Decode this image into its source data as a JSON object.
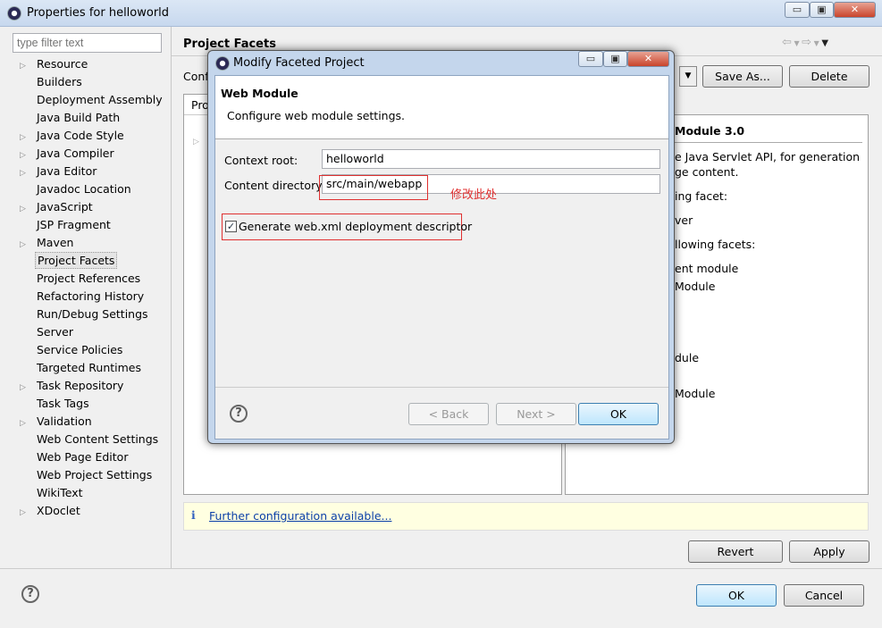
{
  "window": {
    "title": "Properties for helloworld",
    "controls": [
      "▭",
      "▣",
      "✕"
    ]
  },
  "filter": {
    "placeholder": "type filter text"
  },
  "tree": [
    {
      "label": "Resource",
      "exp": true
    },
    {
      "label": "Builders"
    },
    {
      "label": "Deployment Assembly"
    },
    {
      "label": "Java Build Path"
    },
    {
      "label": "Java Code Style",
      "exp": true
    },
    {
      "label": "Java Compiler",
      "exp": true
    },
    {
      "label": "Java Editor",
      "exp": true
    },
    {
      "label": "Javadoc Location"
    },
    {
      "label": "JavaScript",
      "exp": true
    },
    {
      "label": "JSP Fragment"
    },
    {
      "label": "Maven",
      "exp": true
    },
    {
      "label": "Project Facets",
      "sel": true
    },
    {
      "label": "Project References"
    },
    {
      "label": "Refactoring History"
    },
    {
      "label": "Run/Debug Settings"
    },
    {
      "label": "Server"
    },
    {
      "label": "Service Policies"
    },
    {
      "label": "Targeted Runtimes"
    },
    {
      "label": "Task Repository",
      "exp": true
    },
    {
      "label": "Task Tags"
    },
    {
      "label": "Validation",
      "exp": true
    },
    {
      "label": "Web Content Settings"
    },
    {
      "label": "Web Page Editor"
    },
    {
      "label": "Web Project Settings"
    },
    {
      "label": "WikiText"
    },
    {
      "label": "XDoclet",
      "exp": true
    }
  ],
  "main": {
    "title": "Project Facets",
    "config_label": "Conf",
    "save_as": "Save As...",
    "delete": "Delete",
    "tab_label": "Pro",
    "details": {
      "title": "Module 3.0",
      "lines": [
        "e Java Servlet API, for generation",
        "ge content.",
        "ing facet:",
        "ver",
        "llowing facets:",
        "ent module",
        "Module",
        "",
        "",
        "dule",
        "",
        "Module"
      ]
    },
    "info_link": "Further configuration available...",
    "revert": "Revert",
    "apply": "Apply",
    "ok": "OK",
    "cancel": "Cancel"
  },
  "dialog": {
    "title": "Modify Faceted Project",
    "header_title": "Web Module",
    "header_desc": "Configure web module settings.",
    "context_root_label": "Context root:",
    "context_root": "helloworld",
    "content_dir_label": "Content directory:",
    "content_dir": "src/main/webapp",
    "annotation": "修改此处",
    "checkbox_label": "Generate web.xml deployment descriptor",
    "checkbox_checked": true,
    "back": "< Back",
    "next": "Next >",
    "ok": "OK"
  },
  "colors": {
    "annotation": "#e03030",
    "info_bg": "#ffffe1"
  }
}
